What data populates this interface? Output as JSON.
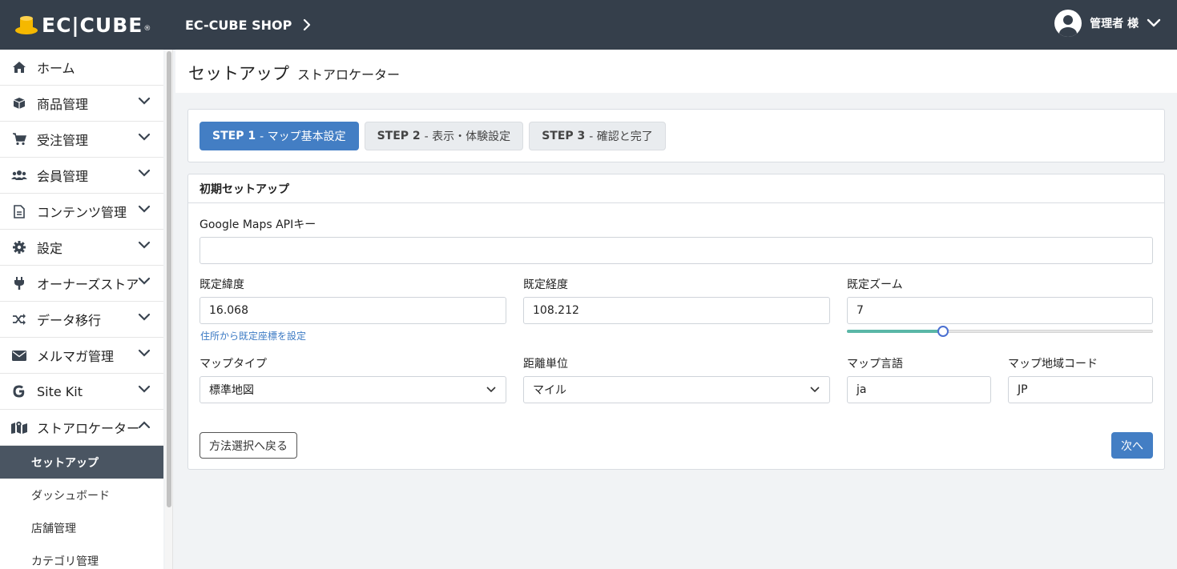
{
  "header": {
    "logo_text": "EC|CUBE",
    "logo_reg": "®",
    "shop_name": "EC-CUBE SHOP",
    "user_name": "管理者 様"
  },
  "sidebar": {
    "items": [
      {
        "label": "ホーム",
        "icon": "home-icon"
      },
      {
        "label": "商品管理",
        "icon": "box-icon"
      },
      {
        "label": "受注管理",
        "icon": "cart-icon"
      },
      {
        "label": "会員管理",
        "icon": "users-icon"
      },
      {
        "label": "コンテンツ管理",
        "icon": "file-icon"
      },
      {
        "label": "設定",
        "icon": "gear-icon"
      },
      {
        "label": "オーナーズストア",
        "icon": "plug-icon"
      },
      {
        "label": "データ移行",
        "icon": "shuffle-icon"
      },
      {
        "label": "メルマガ管理",
        "icon": "envelope-icon"
      },
      {
        "label": "Site Kit",
        "icon": "google-icon"
      },
      {
        "label": "ストアロケーター",
        "icon": "map-icon"
      }
    ],
    "subitems": [
      {
        "label": "セットアップ",
        "active": true
      },
      {
        "label": "ダッシュボード"
      },
      {
        "label": "店舗管理"
      },
      {
        "label": "カテゴリ管理"
      }
    ]
  },
  "page": {
    "title": "セットアップ",
    "subtitle": "ストアロケーター"
  },
  "steps": [
    {
      "num": "STEP 1",
      "label": "- マップ基本設定",
      "active": true
    },
    {
      "num": "STEP 2",
      "label": "- 表示・体験設定"
    },
    {
      "num": "STEP 3",
      "label": "- 確認と完了"
    }
  ],
  "setup": {
    "heading": "初期セットアップ",
    "api_key_label": "Google Maps APIキー",
    "api_key_value": "",
    "lat_label": "既定緯度",
    "lat_value": "16.068",
    "lng_label": "既定経度",
    "lng_value": "108.212",
    "zoom_label": "既定ズーム",
    "zoom_value": "7",
    "geocode_link": "住所から既定座標を設定",
    "map_type_label": "マップタイプ",
    "map_type_value": "標準地図",
    "unit_label": "距離単位",
    "unit_value": "マイル",
    "lang_label": "マップ言語",
    "lang_value": "ja",
    "region_label": "マップ地域コード",
    "region_value": "JP",
    "back_button": "方法選択へ戻る",
    "next_button": "次へ"
  },
  "colors": {
    "header_bg": "#353f4b",
    "primary": "#437ec4",
    "active_sub": "#4a5562",
    "slider_fill": "#5ab7a7"
  }
}
